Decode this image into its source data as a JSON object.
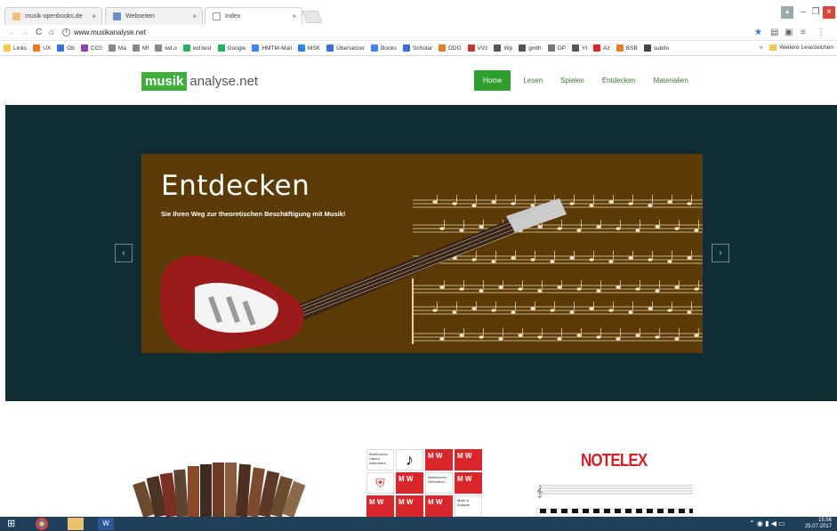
{
  "browser": {
    "tabs": [
      {
        "title": "musik-openbooks.de",
        "active": false
      },
      {
        "title": "Webseiten",
        "active": false
      },
      {
        "title": "Index",
        "active": true
      }
    ],
    "url": "www.musikanalyse.net",
    "bookmarks": [
      "Links",
      "UX",
      "Ob",
      "CC0",
      "Ma",
      "Mf",
      "wd.o",
      "wd.test",
      "Google",
      "HMTM-Mail",
      "MSK",
      "Übersetzer",
      "Books",
      "Scholar",
      "DDG",
      "VVz",
      "Wp",
      "gmth",
      "OP",
      "Yt",
      "Az",
      "BSB",
      "subito"
    ],
    "bookmarks_more": "»",
    "other_bookmarks": "Weitere Lesezeichen"
  },
  "site": {
    "logo_box": "musik",
    "logo_rest": "analyse.net",
    "nav": [
      "Home",
      "Lesen",
      "Spielen",
      "Entdecken",
      "Materialien"
    ],
    "active_nav": "Home",
    "slide_title": "Entdecken",
    "slide_subtitle": "Sie Ihren Weg zur theoretischen Beschäftigung mit Musik!",
    "prev": "‹",
    "next": "›",
    "notelex": "NOTELEX",
    "tiles": {
      "t1": "Beethovens Hauen instrument",
      "t2": "Beethovens Geburtsort",
      "t3": "Motiv & Analyse",
      "mw": "M W"
    }
  },
  "taskbar": {
    "time": "15:56",
    "date": "25.07.2017"
  },
  "colors": {
    "brand_green": "#3fae3f",
    "hero_bg": "#102c34",
    "slide_bg": "#5b3a05",
    "tile_red": "#d8262b"
  }
}
